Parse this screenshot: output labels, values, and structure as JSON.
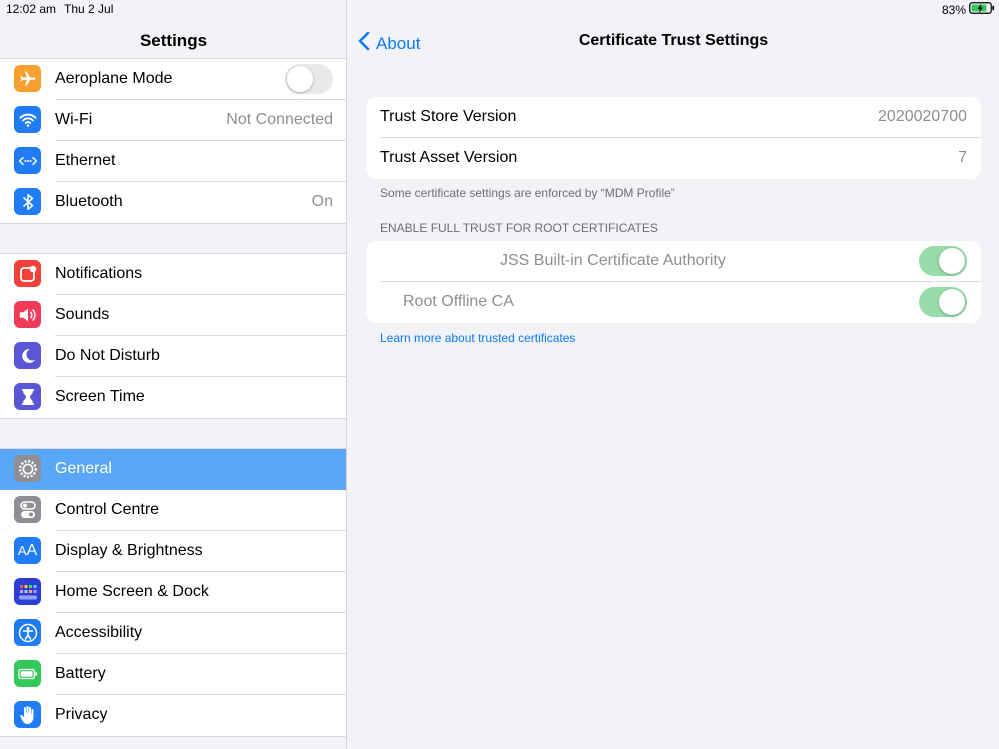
{
  "status_bar": {
    "time": "12:02 am",
    "date": "Thu 2 Jul",
    "battery": "83%"
  },
  "colors": {
    "accent": "#0a7bf6",
    "selected_row": "#5aa7f8",
    "toggle_on": "#98dcaa"
  },
  "sidebar": {
    "title": "Settings",
    "groups": [
      [
        {
          "label": "Aeroplane Mode",
          "icon": "airplane-icon",
          "toggle": "off"
        },
        {
          "label": "Wi-Fi",
          "icon": "wifi-icon",
          "value": "Not Connected"
        },
        {
          "label": "Ethernet",
          "icon": "ethernet-icon"
        },
        {
          "label": "Bluetooth",
          "icon": "bluetooth-icon",
          "value": "On"
        }
      ],
      [
        {
          "label": "Notifications",
          "icon": "notifications-icon"
        },
        {
          "label": "Sounds",
          "icon": "sounds-icon"
        },
        {
          "label": "Do Not Disturb",
          "icon": "moon-icon"
        },
        {
          "label": "Screen Time",
          "icon": "hourglass-icon"
        }
      ],
      [
        {
          "label": "General",
          "icon": "gear-icon",
          "selected": true
        },
        {
          "label": "Control Centre",
          "icon": "control-centre-icon"
        },
        {
          "label": "Display & Brightness",
          "icon": "display-brightness-icon"
        },
        {
          "label": "Home Screen & Dock",
          "icon": "home-screen-icon"
        },
        {
          "label": "Accessibility",
          "icon": "accessibility-icon"
        },
        {
          "label": "Battery",
          "icon": "battery-icon"
        },
        {
          "label": "Privacy",
          "icon": "hand-icon"
        }
      ]
    ]
  },
  "detail": {
    "back_label": "About",
    "title": "Certificate Trust Settings",
    "versions": [
      {
        "label": "Trust Store Version",
        "value": "2020020700"
      },
      {
        "label": "Trust Asset Version",
        "value": "7"
      }
    ],
    "mdm_note": "Some certificate settings are enforced by “MDM Profile”",
    "section_header": "ENABLE FULL TRUST FOR ROOT CERTIFICATES",
    "certificates": [
      {
        "label": "JSS Built-in Certificate Authority",
        "enabled": true
      },
      {
        "label": "Root Offline CA",
        "enabled": true
      }
    ],
    "learn_more": "Learn more about trusted certificates"
  }
}
